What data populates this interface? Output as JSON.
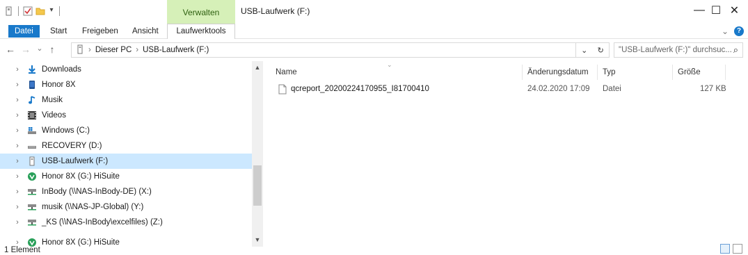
{
  "window": {
    "title": "USB-Laufwerk (F:)",
    "context_tab_group": "Verwalten",
    "controls": {
      "minimize": "—",
      "maximize": "☐",
      "close": "✕"
    }
  },
  "ribbon": {
    "tabs": [
      {
        "label": "Datei"
      },
      {
        "label": "Start"
      },
      {
        "label": "Freigeben"
      },
      {
        "label": "Ansicht"
      },
      {
        "label": "Laufwerktools"
      }
    ],
    "expand": "⌄",
    "help": "?"
  },
  "address": {
    "back": "←",
    "forward": "→",
    "recent": "⌄",
    "up": "↑",
    "separator": "›",
    "path": [
      "Dieser PC",
      "USB-Laufwerk (F:)"
    ],
    "dropdown": "⌄",
    "refresh": "↻",
    "search_placeholder": "\"USB-Laufwerk (F:)\" durchsuc...",
    "search_icon": "⌕"
  },
  "nav_tree": {
    "chevron": "›",
    "items": [
      {
        "label": "Downloads",
        "icon": "download-icon"
      },
      {
        "label": "Honor 8X",
        "icon": "phone-icon"
      },
      {
        "label": "Musik",
        "icon": "music-icon"
      },
      {
        "label": "Videos",
        "icon": "video-icon"
      },
      {
        "label": "Windows (C:)",
        "icon": "windows-drive-icon"
      },
      {
        "label": "RECOVERY (D:)",
        "icon": "drive-icon"
      },
      {
        "label": "USB-Laufwerk (F:)",
        "icon": "usb-drive-icon",
        "selected": true
      },
      {
        "label": "Honor 8X (G:) HiSuite",
        "icon": "hisuite-icon"
      },
      {
        "label": "InBody (\\\\NAS-InBody-DE) (X:)",
        "icon": "network-drive-icon"
      },
      {
        "label": "musik (\\\\NAS-JP-Global) (Y:)",
        "icon": "network-drive-icon"
      },
      {
        "label": "_KS (\\\\NAS-InBody\\excelfiles) (Z:)",
        "icon": "network-drive-icon"
      },
      {
        "label": "Honor 8X (G:) HiSuite",
        "icon": "hisuite-icon"
      }
    ],
    "scroll_up": "▲",
    "scroll_down": "▼"
  },
  "file_list": {
    "sort_indicator": "⌄",
    "columns": [
      "Name",
      "Änderungsdatum",
      "Typ",
      "Größe"
    ],
    "rows": [
      {
        "name": "qcreport_20200224170955_I81700410",
        "date": "24.02.2020 17:09",
        "type": "Datei",
        "size": "127 KB"
      }
    ]
  },
  "status": {
    "text": "1 Element"
  },
  "colors": {
    "accent": "#1979ca",
    "selection": "#cce8ff",
    "context_tab": "#d6f0b8"
  }
}
